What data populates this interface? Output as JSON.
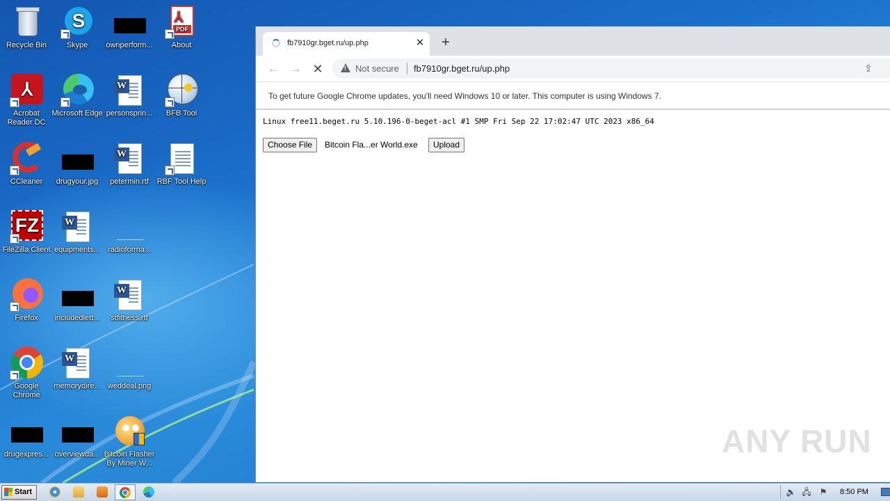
{
  "desktop": {
    "icons": [
      {
        "label": "Recycle Bin",
        "icon": "recycle-bin-icon"
      },
      {
        "label": "Skype",
        "icon": "skype-icon"
      },
      {
        "label": "ownperform...",
        "icon": "redacted-file-icon"
      },
      {
        "label": "About",
        "icon": "pdf-icon"
      },
      {
        "label": "Acrobat Reader DC",
        "icon": "acrobat-icon"
      },
      {
        "label": "Microsoft Edge",
        "icon": "edge-icon"
      },
      {
        "label": "personsprin...",
        "icon": "word-doc-icon"
      },
      {
        "label": "BFB Tool",
        "icon": "globe-icon"
      },
      {
        "label": "CCleaner",
        "icon": "ccleaner-icon"
      },
      {
        "label": "drugyour.jpg",
        "icon": "redacted-file-icon"
      },
      {
        "label": "petermin.rtf",
        "icon": "word-doc-icon"
      },
      {
        "label": "RBF Tool Help",
        "icon": "text-file-icon"
      },
      {
        "label": "FileZilla Client",
        "icon": "filezilla-icon"
      },
      {
        "label": "equipments...",
        "icon": "word-doc-icon"
      },
      {
        "label": "radioforma...",
        "icon": "blank-file-icon"
      },
      {
        "label": "Firefox",
        "icon": "firefox-icon"
      },
      {
        "label": "includedlett...",
        "icon": "redacted-file-icon"
      },
      {
        "label": "stfitness.rtf",
        "icon": "word-doc-icon"
      },
      {
        "label": "Google Chrome",
        "icon": "chrome-icon"
      },
      {
        "label": "memorydire...",
        "icon": "word-doc-icon"
      },
      {
        "label": "weddeal.png",
        "icon": "blank-file-icon"
      },
      {
        "label": "drugexpres...",
        "icon": "redacted-file-icon"
      },
      {
        "label": "overviewda...",
        "icon": "redacted-file-icon"
      },
      {
        "label": "Bitcoin Flasher By Miner W...",
        "icon": "bitcoin-flasher-icon"
      }
    ]
  },
  "browser": {
    "tab_title": "fb7910gr.bget.ru/up.php",
    "tab_close": "✕",
    "new_tab": "+",
    "security_label": "Not secure",
    "url": "fb7910gr.bget.ru/up.php",
    "infobar_text": "To get future Google Chrome updates, you'll need Windows 10 or later. This computer is using Windows 7.",
    "page": {
      "uname": "Linux free11.beget.ru 5.10.196-0-beget-acl #1 SMP Fri Sep 22 17:02:47 UTC 2023 x86_64",
      "choose_file_label": "Choose File",
      "selected_file": "Bitcoin Fla...er World.exe",
      "upload_label": "Upload"
    },
    "watermark": "ANY RUN"
  },
  "taskbar": {
    "start_label": "Start",
    "clock": "8:50 PM"
  }
}
